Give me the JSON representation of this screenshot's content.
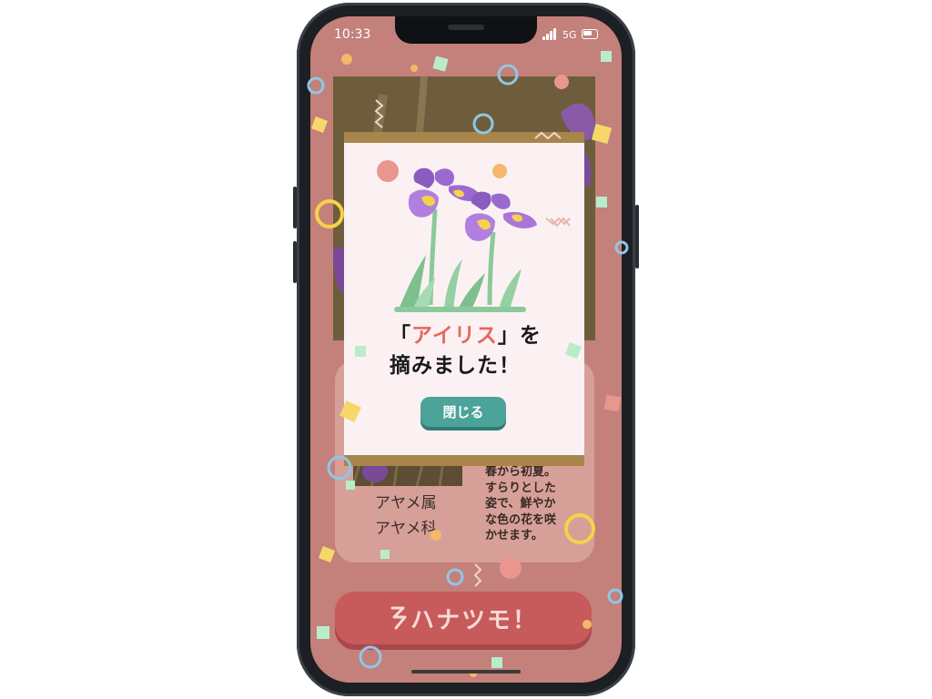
{
  "status_bar": {
    "time": "10:33",
    "network": "5G"
  },
  "plant_info": {
    "genus": "アヤメ属",
    "family": "アヤメ科",
    "description": [
      "春から初夏。",
      "すらりとした",
      "姿で、鮮やか",
      "な色の花を咲",
      "かせます。"
    ]
  },
  "cta": {
    "label": "ハナツモ！"
  },
  "modal": {
    "title_prefix": "「",
    "flower_name": "アイリス",
    "title_suffix": "」を",
    "title_line2": "摘みました！",
    "close_label": "閉じる"
  },
  "colors": {
    "screen_bg": "#c4807a",
    "accent_red": "#c75a5a",
    "highlight": "#e5685f",
    "button_teal": "#4ba39a",
    "modal_bg": "#fbf1f3",
    "modal_frame": "#a8854a"
  },
  "icons": [
    "signal-icon",
    "battery-icon",
    "iris-flower-illustration",
    "sparkle-icon"
  ]
}
